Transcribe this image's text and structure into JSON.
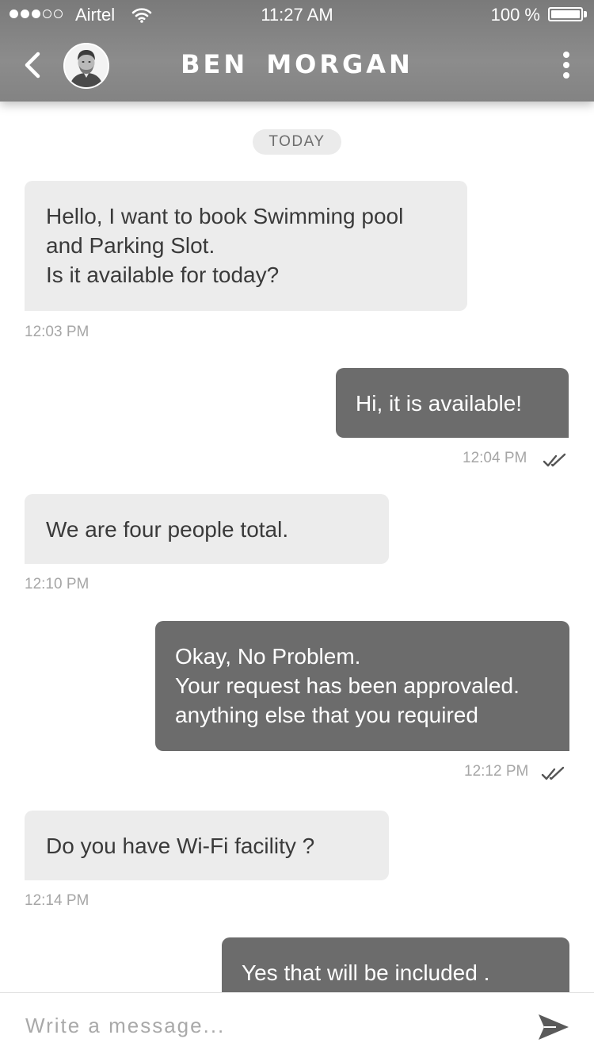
{
  "status_bar": {
    "carrier": "Airtel",
    "time": "11:27 AM",
    "battery": "100 %",
    "battery_level": 1.0,
    "signal_bars_filled": 3,
    "signal_bars_total": 5
  },
  "header": {
    "contact_name": "BEN  MORGAN",
    "icons": {
      "back": "chevron-left-icon",
      "menu": "more-vertical-icon"
    }
  },
  "conversation": {
    "day_label": "TODAY",
    "messages": [
      {
        "direction": "incoming",
        "text": "Hello, I want to book Swimming pool\nand Parking Slot.\nIs it  available for today?",
        "time": "12:03 PM"
      },
      {
        "direction": "outgoing",
        "text": "Hi, it is available!",
        "time": "12:04 PM",
        "read": true
      },
      {
        "direction": "incoming",
        "text": "We are four people total.",
        "time": "12:10 PM"
      },
      {
        "direction": "outgoing",
        "text": "Okay, No Problem.\nYour request has been approvaled.\nanything else that you required",
        "time": "12:12 PM",
        "read": true
      },
      {
        "direction": "incoming",
        "text": "Do you have Wi-Fi facility ?",
        "time": "12:14 PM"
      },
      {
        "direction": "outgoing",
        "text": "Yes that will be included .",
        "read": true
      }
    ]
  },
  "composer": {
    "placeholder": "Write a message...",
    "send_icon": "send-icon"
  },
  "colors": {
    "header_bg": "#848484",
    "incoming_bubble": "#ececec",
    "outgoing_bubble": "#6c6c6c",
    "timestamp": "#a6a6a6"
  }
}
